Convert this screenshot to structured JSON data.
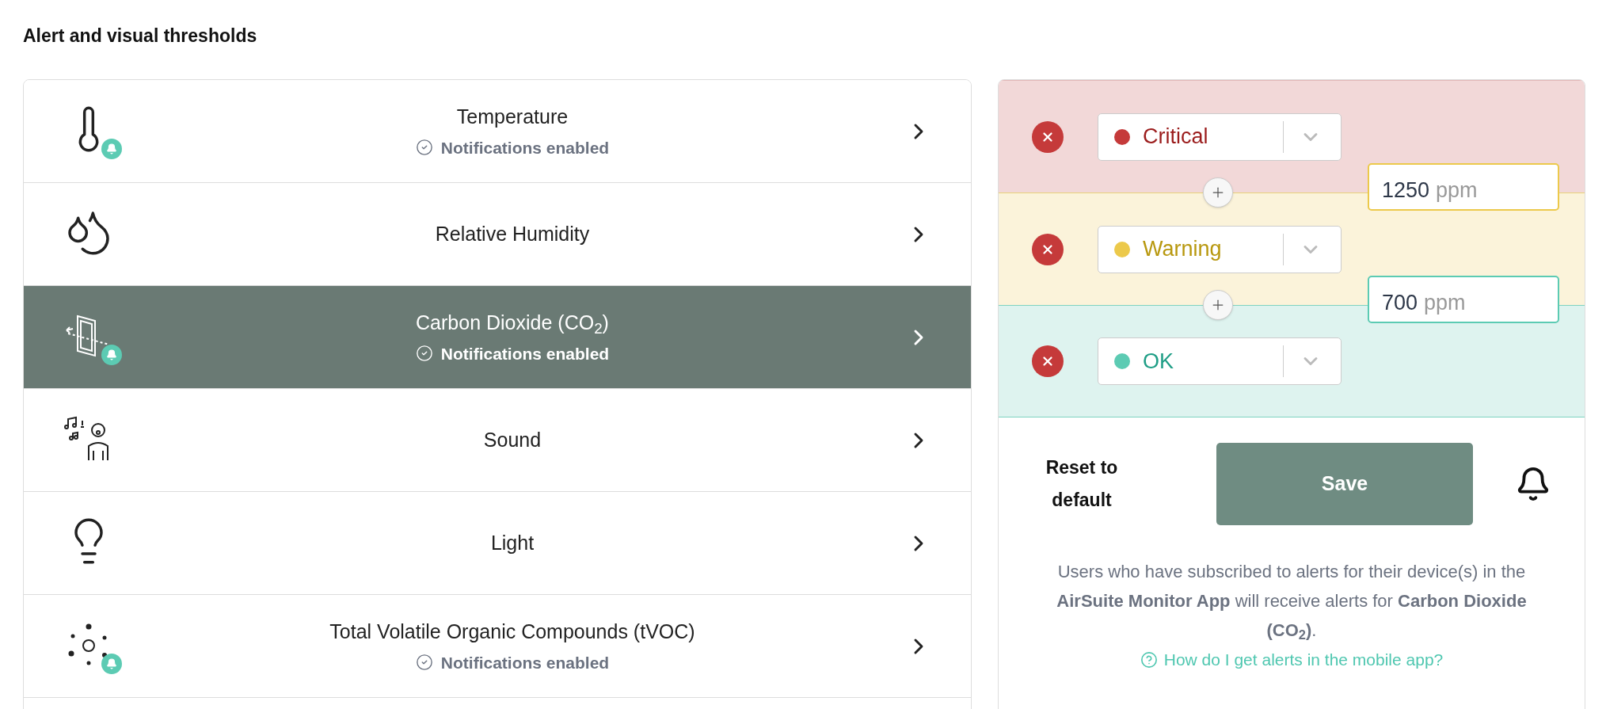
{
  "heading": "Alert and visual thresholds",
  "sensors": [
    {
      "name": "Temperature",
      "status": "Notifications enabled",
      "bell_badge": true,
      "selected": false
    },
    {
      "name": "Relative Humidity",
      "bell_badge": false,
      "selected": false
    },
    {
      "name": "Carbon Dioxide (CO$_{2}$)",
      "status": "Notifications enabled",
      "bell_badge": true,
      "selected": true
    },
    {
      "name": "Sound",
      "bell_badge": false,
      "selected": false
    },
    {
      "name": "Light",
      "bell_badge": false,
      "selected": false
    },
    {
      "name": "Total Volatile Organic Compounds (tVOC)",
      "status": "Notifications enabled",
      "bell_badge": true,
      "selected": false
    }
  ],
  "levels": [
    {
      "kind": "critical",
      "label": "Critical",
      "color": "#c53a3a"
    },
    {
      "kind": "warning",
      "label": "Warning",
      "color": "#ecc94b"
    },
    {
      "kind": "ok",
      "label": "OK",
      "color": "#5ccbb3"
    }
  ],
  "boundaries": [
    {
      "value": "1250",
      "unit": "ppm"
    },
    {
      "value": "700",
      "unit": "ppm"
    }
  ],
  "reset_label": "Reset to default",
  "save_label": "Save",
  "info_text": "Users who have subscribed to alerts for their device(s) in the **AirSuite Monitor App** will receive alerts for **Carbon Dioxide (CO$_{2}$)**.",
  "help_link": "How do I get alerts in the mobile app?"
}
